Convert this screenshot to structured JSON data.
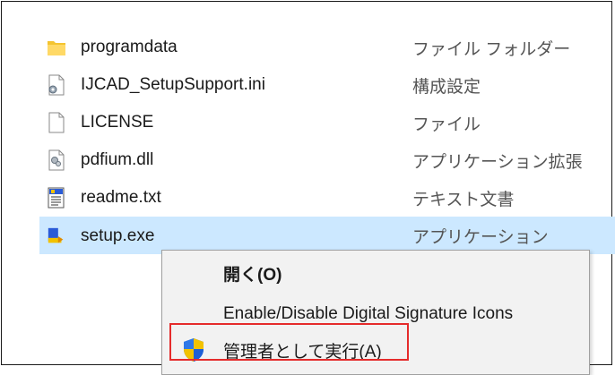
{
  "files": [
    {
      "name": "programdata",
      "type": "ファイル フォルダー",
      "icon": "folder-icon"
    },
    {
      "name": "IJCAD_SetupSupport.ini",
      "type": "構成設定",
      "icon": "config-file-icon"
    },
    {
      "name": "LICENSE",
      "type": "ファイル",
      "icon": "blank-file-icon"
    },
    {
      "name": "pdfium.dll",
      "type": "アプリケーション拡張",
      "icon": "dll-file-icon"
    },
    {
      "name": "readme.txt",
      "type": "テキスト文書",
      "icon": "text-file-icon"
    },
    {
      "name": "setup.exe",
      "type": "アプリケーション",
      "icon": "installer-icon",
      "selected": true
    }
  ],
  "context_menu": {
    "items": [
      {
        "label": "開く(O)"
      },
      {
        "label": "Enable/Disable Digital Signature Icons"
      },
      {
        "label": "管理者として実行(A)",
        "icon": "uac-shield-icon",
        "highlighted": true
      }
    ]
  },
  "colors": {
    "selection": "#cce8ff",
    "highlight_border": "#e52b2b",
    "menu_background": "#f2f2f2"
  }
}
